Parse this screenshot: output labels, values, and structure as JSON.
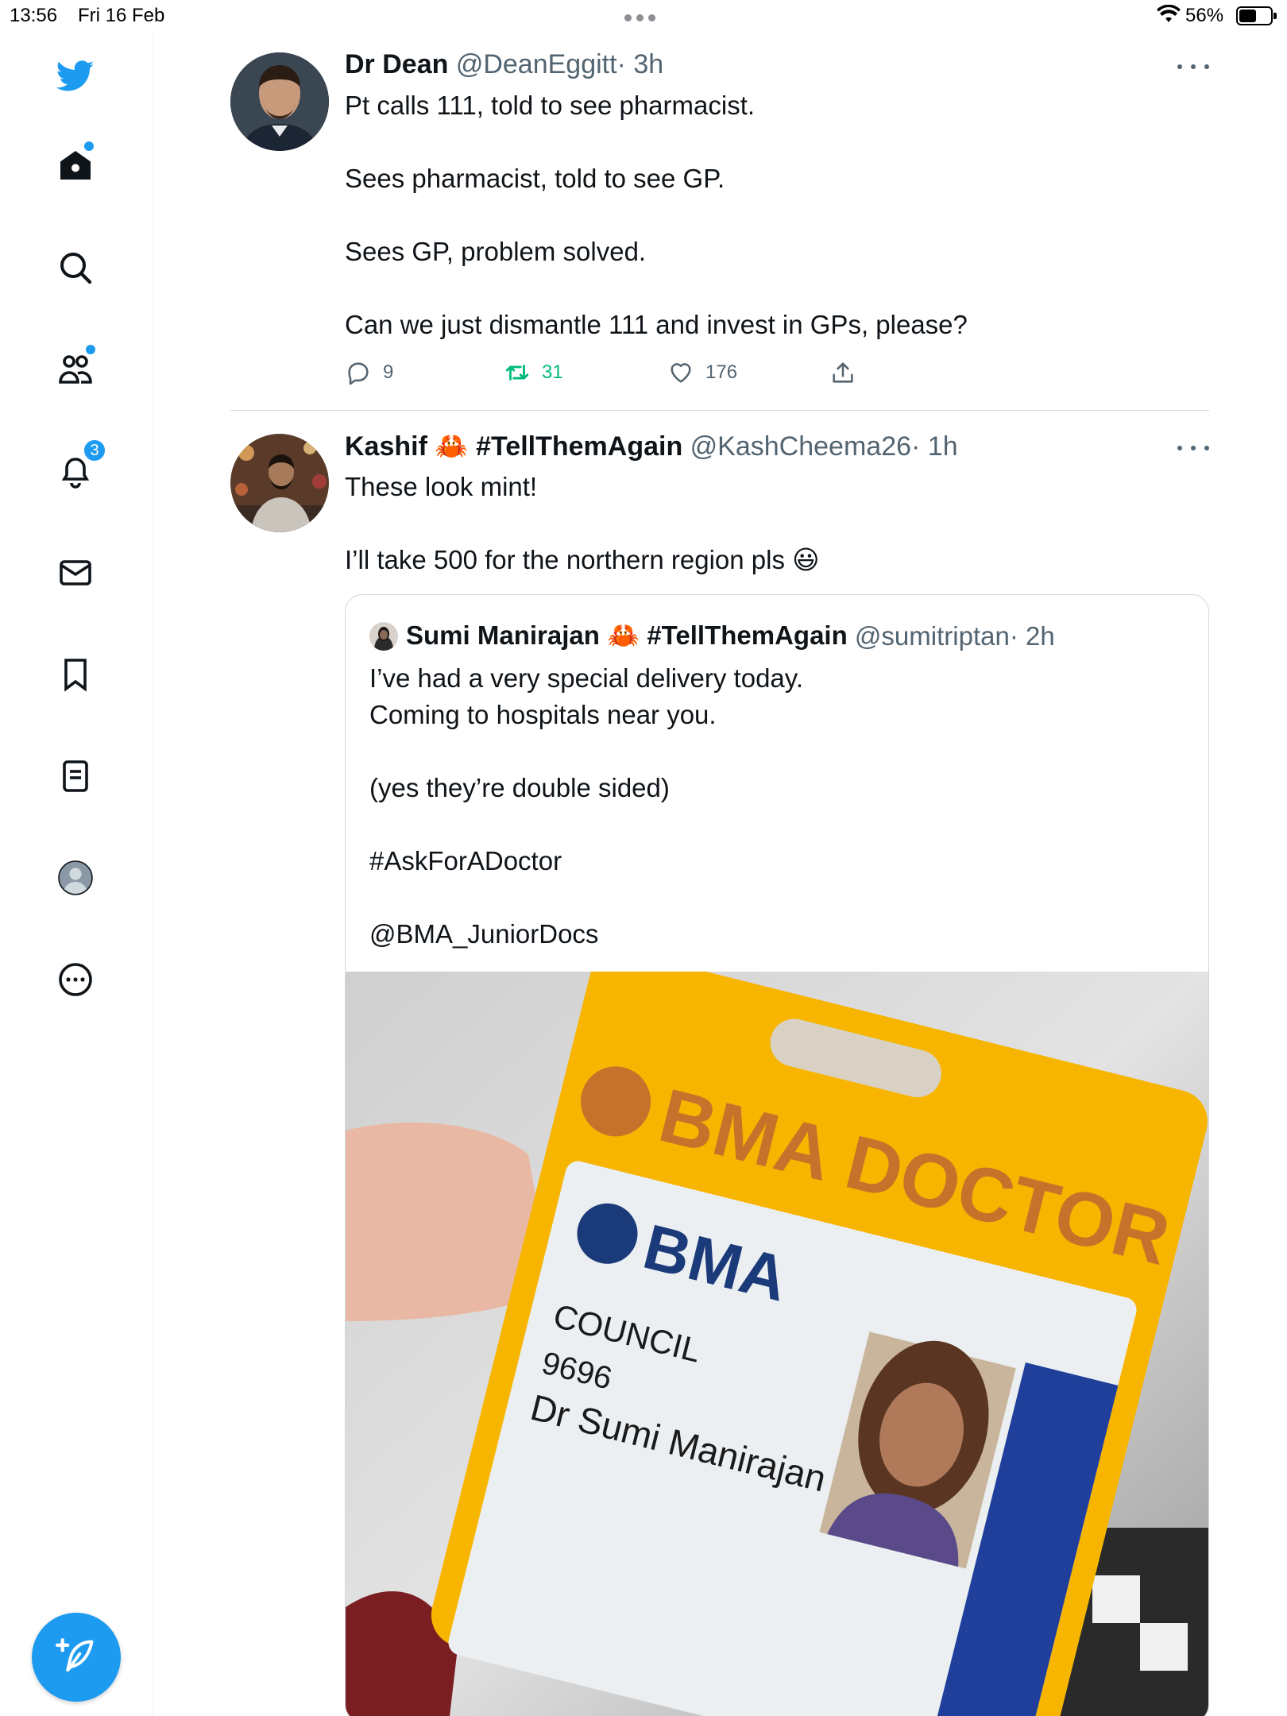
{
  "status_bar": {
    "time": "13:56",
    "date": "Fri 16 Feb",
    "battery": "56%",
    "battery_level": 0.56
  },
  "sidebar": {
    "items": [
      {
        "name": "twitter-logo",
        "icon": "bird-icon"
      },
      {
        "name": "home",
        "icon": "home-icon",
        "unread_dot": true
      },
      {
        "name": "explore",
        "icon": "search-icon"
      },
      {
        "name": "communities",
        "icon": "communities-icon",
        "unread_dot": true
      },
      {
        "name": "notifications",
        "icon": "bell-icon",
        "badge": "3"
      },
      {
        "name": "messages",
        "icon": "mail-icon"
      },
      {
        "name": "bookmarks",
        "icon": "bookmark-icon"
      },
      {
        "name": "lists",
        "icon": "list-icon"
      },
      {
        "name": "profile",
        "icon": "profile-avatar-icon"
      },
      {
        "name": "more",
        "icon": "more-circle-icon"
      }
    ],
    "compose_icon": "feather-plus-icon"
  },
  "tweets": [
    {
      "name": "Dr Dean",
      "handle": "@DeanEggitt",
      "time": "· 3h",
      "text": "Pt calls 111, told to see pharmacist.\n\nSees pharmacist, told to see GP.\n\nSees GP, problem solved.\n\nCan we just dismantle 111 and invest in GPs, please?",
      "replies": "9",
      "retweets": "31",
      "likes": "176",
      "retweeted": true
    },
    {
      "name": "Kashif 🦀 #TellThemAgain",
      "handle": "@KashCheema26",
      "time": "· 1h",
      "text": "These look mint!\n\nI’ll take 500 for the northern region pls 😃",
      "quote": {
        "name": "Sumi Manirajan 🦀 #TellThemAgain",
        "handle": "@sumitriptan",
        "time": "· 2h",
        "text": "I’ve had a very special delivery today.\nComing to hospitals near you.\n\n(yes they’re double sided)\n\n#AskForADoctor\n\n@BMA_JuniorDocs",
        "image": {
          "holder_text": "BMA DOCTOR",
          "card_logo": "BMA",
          "card_role": "COUNCIL",
          "card_number": "9696",
          "card_name": "Dr Sumi Manirajan"
        }
      }
    }
  ],
  "colors": {
    "accent": "#1d9bf0",
    "retweet_green": "#00ba7c",
    "secondary_text": "#536471",
    "badge_holder": "#f7b500"
  }
}
